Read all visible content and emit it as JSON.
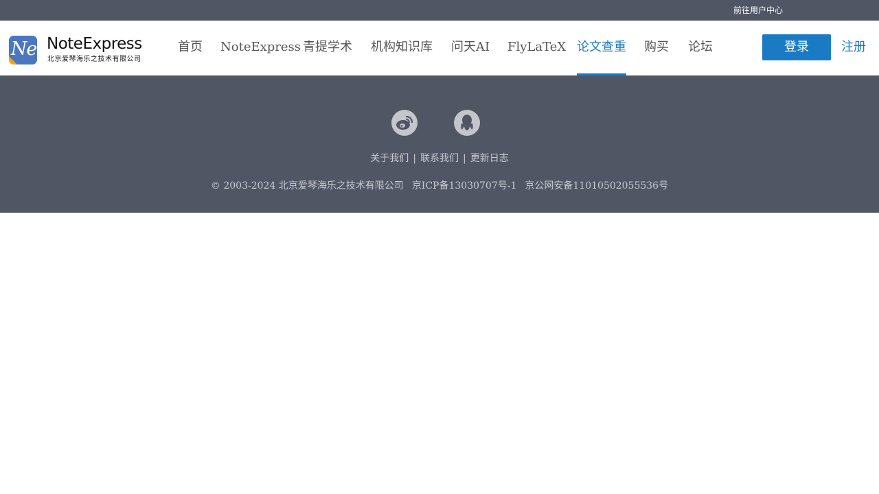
{
  "topbar": {
    "user_center_label": "前往用户中心"
  },
  "logo": {
    "mark_letters": "Ne",
    "name": "NoteExpress",
    "company": "北京爱琴海乐之技术有限公司"
  },
  "nav": {
    "items": [
      {
        "label": "首页"
      },
      {
        "label": "NoteExpress"
      },
      {
        "label": "青提学术"
      },
      {
        "label": "机构知识库"
      },
      {
        "label": "问天AI"
      },
      {
        "label": "FlyLaTeX"
      },
      {
        "label": "论文查重",
        "active": true
      },
      {
        "label": "购买"
      },
      {
        "label": "论坛"
      }
    ]
  },
  "auth": {
    "login_label": "登录",
    "register_label": "注册"
  },
  "footer": {
    "social": [
      {
        "icon": "weibo-icon"
      },
      {
        "icon": "qq-icon"
      }
    ],
    "links": [
      {
        "label": "关于我们"
      },
      {
        "label": "联系我们"
      },
      {
        "label": "更新日志"
      }
    ],
    "separator": "|",
    "copyright": "© 2003-2024 北京爱琴海乐之技术有限公司",
    "icp": "京ICP备13030707号-1",
    "police": "京公网安备11010502055536号"
  },
  "colors": {
    "header_bg": "#515665",
    "accent": "#1a7bc4"
  }
}
